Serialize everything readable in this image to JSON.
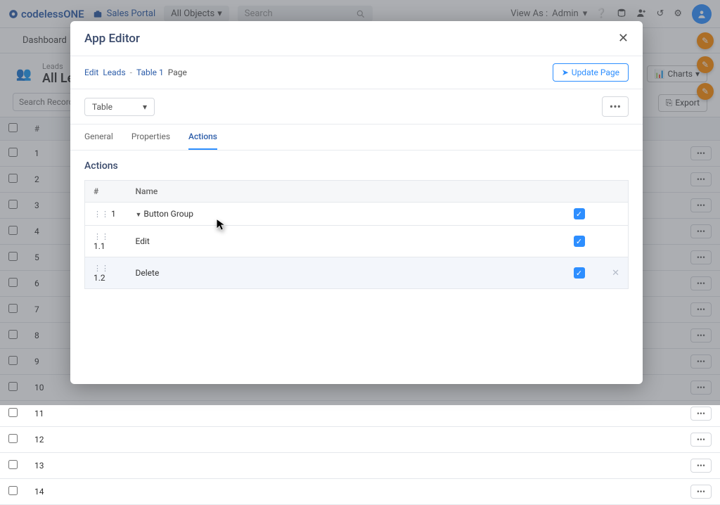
{
  "nav": {
    "logo_text": "codelessONE",
    "portal": "Sales Portal",
    "all_objects": "All Objects",
    "search_placeholder": "Search",
    "view_as_label": "View As :",
    "view_as_value": "Admin"
  },
  "subnav": {
    "dashboard": "Dashboard"
  },
  "page": {
    "crumb": "Leads",
    "title": "All Leads",
    "search_placeholder": "Search Records",
    "charts_btn": "Charts",
    "export_btn": "Export"
  },
  "table": {
    "col_num": "#",
    "rows": [
      {
        "n": "1"
      },
      {
        "n": "2"
      },
      {
        "n": "3"
      },
      {
        "n": "4"
      },
      {
        "n": "5"
      },
      {
        "n": "6"
      },
      {
        "n": "7"
      },
      {
        "n": "8"
      },
      {
        "n": "9"
      },
      {
        "n": "10"
      },
      {
        "n": "11"
      },
      {
        "n": "12"
      },
      {
        "n": "13"
      },
      {
        "n": "14"
      }
    ]
  },
  "modal": {
    "title": "App Editor",
    "crumb1": "Edit",
    "crumb2": "Leads",
    "crumb3": "Table 1",
    "crumb4": "Page",
    "update_btn": "Update Page",
    "table_select": "Table",
    "tabs": {
      "general": "General",
      "properties": "Properties",
      "actions": "Actions"
    },
    "section": "Actions",
    "headers": {
      "num": "#",
      "name": "Name"
    },
    "rows": [
      {
        "num": "1",
        "name": "Button Group",
        "expandable": true,
        "checked": true
      },
      {
        "num": "1.1",
        "name": "Edit",
        "expandable": false,
        "checked": true
      },
      {
        "num": "1.2",
        "name": "Delete",
        "expandable": false,
        "checked": true,
        "hover": true
      }
    ]
  }
}
